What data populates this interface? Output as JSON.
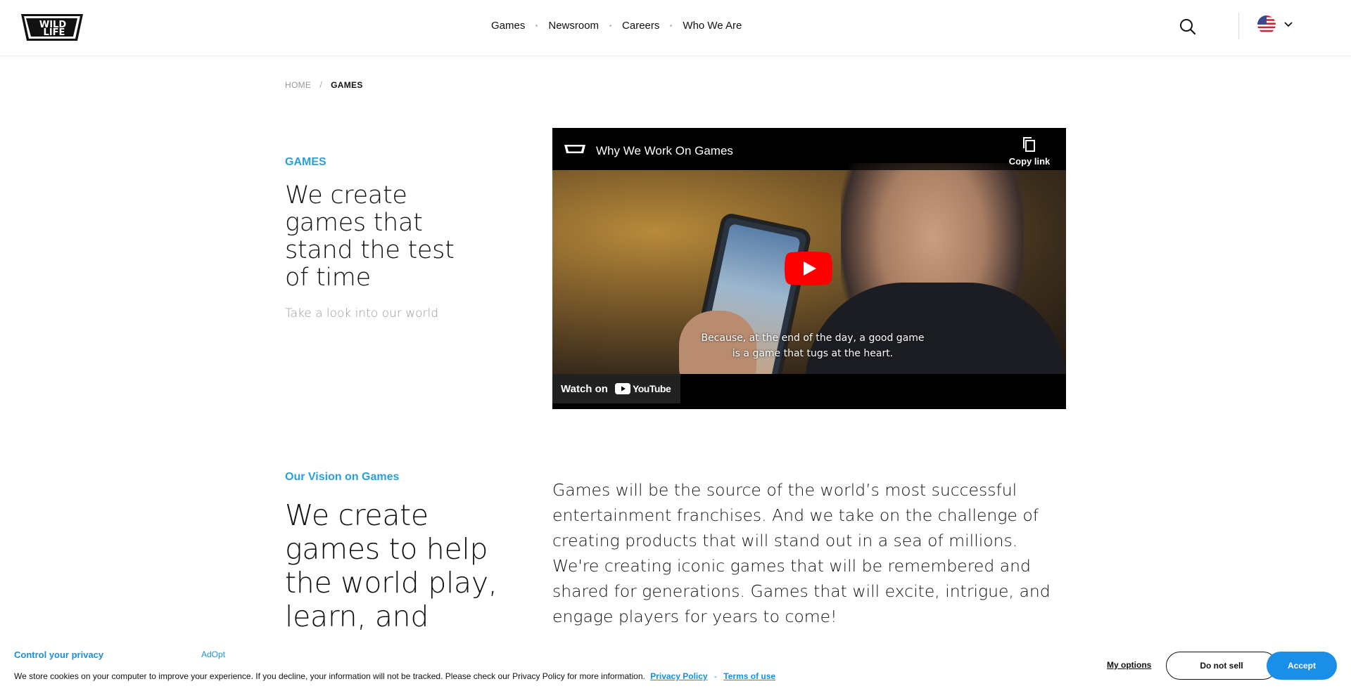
{
  "brand": {
    "logo_text_top": "WILD",
    "logo_text_bottom": "LIFE"
  },
  "nav": {
    "items": [
      {
        "label": "Games"
      },
      {
        "label": "Newsroom"
      },
      {
        "label": "Careers"
      },
      {
        "label": "Who We Are"
      }
    ]
  },
  "header": {
    "search_icon": "search-icon",
    "language_icon": "us-flag-icon"
  },
  "breadcrumb": {
    "home": "HOME",
    "separator": "/",
    "current": "GAMES"
  },
  "hero": {
    "eyebrow": "GAMES",
    "title": "We create games that stand the test of time",
    "subtitle": "Take a look into our world"
  },
  "video": {
    "title": "Why We Work On Games",
    "copy_link": "Copy link",
    "caption_line1": "Because, at the end of the day, a good game",
    "caption_line2": "is a game that tugs at the heart.",
    "watch_on": "Watch on",
    "youtube": "YouTube"
  },
  "vision": {
    "eyebrow": "Our Vision on Games",
    "title": "We create games to help the world play, learn, and",
    "body": "Games will be the source of the world’s most successful entertainment franchises. And we take on the challenge of creating products that will stand out in a sea of millions. We're creating iconic games that will be remembered and shared for generations. Games that will excite, intrigue, and engage players for years to come!"
  },
  "cookie": {
    "title": "Control your privacy",
    "brand": "AdOpt",
    "text": "We store cookies on your computer to improve your experience. If you decline, your information will not be tracked. Please check our Privacy Policy for more information.",
    "privacy_link": "Privacy Policy",
    "dash": "-",
    "terms_link": "Terms of use",
    "options": "My options",
    "do_not_sell": "Do not sell",
    "accept": "Accept"
  },
  "colors": {
    "accent": "#2a9fd8",
    "cookie_accent": "#1b8fd8",
    "accept_button": "#1b8fe8",
    "youtube_red": "#ff0000"
  }
}
